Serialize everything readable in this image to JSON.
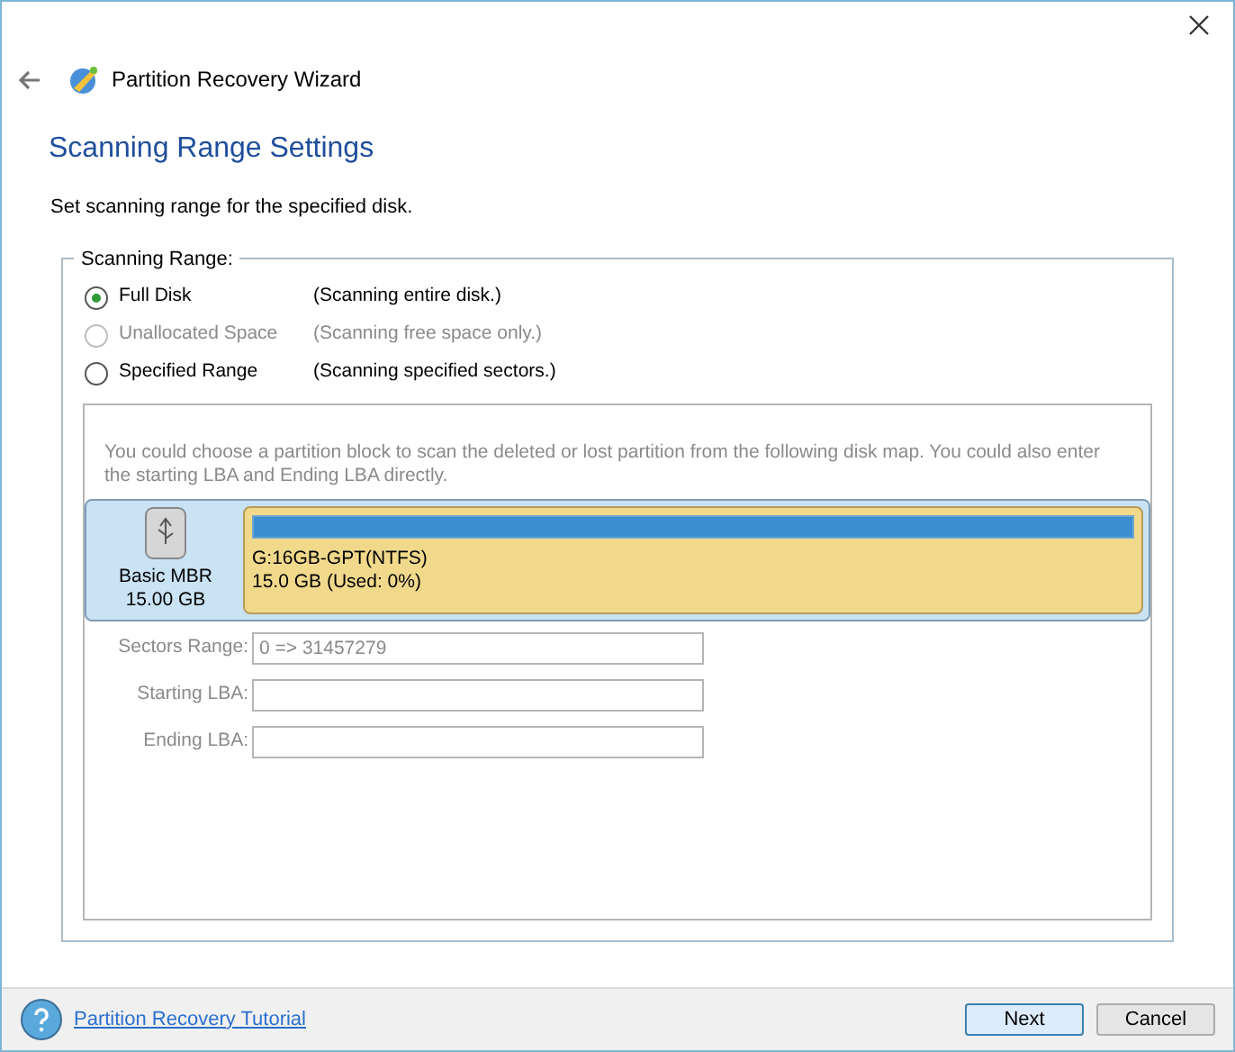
{
  "window": {
    "title": "Partition Recovery Wizard"
  },
  "heading": "Scanning Range Settings",
  "subtitle": "Set scanning range for the specified disk.",
  "scanning_range": {
    "legend": "Scanning Range:",
    "options": [
      {
        "label": "Full Disk",
        "hint": "(Scanning entire disk.)",
        "selected": true,
        "disabled": false
      },
      {
        "label": "Unallocated Space",
        "hint": "(Scanning free space only.)",
        "selected": false,
        "disabled": true
      },
      {
        "label": "Specified Range",
        "hint": "(Scanning specified sectors.)",
        "selected": false,
        "disabled": false
      }
    ]
  },
  "range_panel": {
    "disabled": true,
    "description": "You could choose a partition block to scan the deleted or lost partition from the following disk map. You could also enter the starting LBA and Ending LBA directly.",
    "disk": {
      "type": "Basic MBR",
      "size": "15.00 GB"
    },
    "partition": {
      "name": "G:16GB-GPT(NTFS)",
      "detail": "15.0 GB (Used: 0%)"
    },
    "fields": [
      {
        "label": "Sectors Range:",
        "value": "0 => 31457279"
      },
      {
        "label": "Starting LBA:"
      },
      {
        "label": "Ending LBA:"
      }
    ]
  },
  "footer": {
    "link": "Partition Recovery Tutorial",
    "buttons": [
      {
        "label": "Next",
        "kind": "primary"
      },
      {
        "label": "Cancel",
        "kind": "secondary"
      }
    ]
  }
}
